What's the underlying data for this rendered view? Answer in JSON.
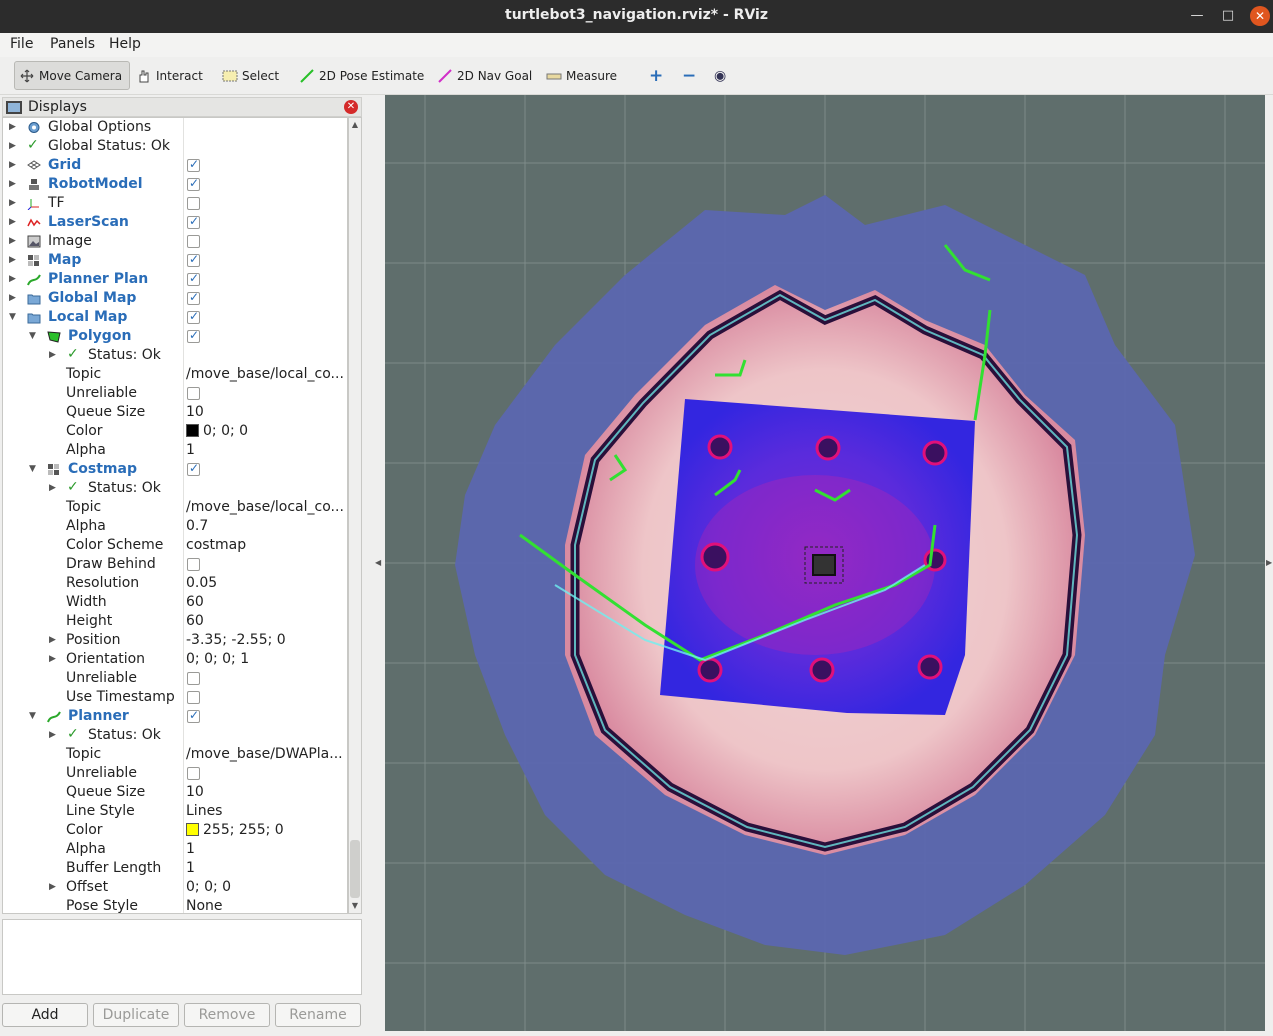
{
  "window": {
    "title": "turtlebot3_navigation.rviz* - RViz",
    "minimize_glyph": "—",
    "maximize_glyph": "□",
    "close_glyph": "✕"
  },
  "menu": [
    "File",
    "Panels",
    "Help"
  ],
  "toolbar": {
    "move_camera": "Move Camera",
    "interact": "Interact",
    "select": "Select",
    "pose_estimate": "2D Pose Estimate",
    "nav_goal": "2D Nav Goal",
    "measure": "Measure"
  },
  "displays": {
    "title": "Displays",
    "rows": [
      {
        "label": "Global Options",
        "value": ""
      },
      {
        "label": "Global Status: Ok",
        "value": ""
      },
      {
        "label": "Grid",
        "value": ""
      },
      {
        "label": "RobotModel",
        "value": ""
      },
      {
        "label": "TF",
        "value": ""
      },
      {
        "label": "LaserScan",
        "value": ""
      },
      {
        "label": "Image",
        "value": ""
      },
      {
        "label": "Map",
        "value": ""
      },
      {
        "label": "Planner Plan",
        "value": ""
      },
      {
        "label": "Global Map",
        "value": ""
      },
      {
        "label": "Local Map",
        "value": ""
      },
      {
        "label": "Polygon",
        "value": ""
      },
      {
        "label": "Status: Ok",
        "value": ""
      },
      {
        "label": "Topic",
        "value": "/move_base/local_co..."
      },
      {
        "label": "Unreliable",
        "value": ""
      },
      {
        "label": "Queue Size",
        "value": "10"
      },
      {
        "label": "Color",
        "value": "0; 0; 0"
      },
      {
        "label": "Alpha",
        "value": "1"
      },
      {
        "label": "Costmap",
        "value": ""
      },
      {
        "label": "Status: Ok",
        "value": ""
      },
      {
        "label": "Topic",
        "value": "/move_base/local_co..."
      },
      {
        "label": "Alpha",
        "value": "0.7"
      },
      {
        "label": "Color Scheme",
        "value": "costmap"
      },
      {
        "label": "Draw Behind",
        "value": ""
      },
      {
        "label": "Resolution",
        "value": "0.05"
      },
      {
        "label": "Width",
        "value": "60"
      },
      {
        "label": "Height",
        "value": "60"
      },
      {
        "label": "Position",
        "value": "-3.35; -2.55; 0"
      },
      {
        "label": "Orientation",
        "value": "0; 0; 0; 1"
      },
      {
        "label": "Unreliable",
        "value": ""
      },
      {
        "label": "Use Timestamp",
        "value": ""
      },
      {
        "label": "Planner",
        "value": ""
      },
      {
        "label": "Status: Ok",
        "value": ""
      },
      {
        "label": "Topic",
        "value": "/move_base/DWAPla..."
      },
      {
        "label": "Unreliable",
        "value": ""
      },
      {
        "label": "Queue Size",
        "value": "10"
      },
      {
        "label": "Line Style",
        "value": "Lines"
      },
      {
        "label": "Color",
        "value": "255; 255; 0"
      },
      {
        "label": "Alpha",
        "value": "1"
      },
      {
        "label": "Buffer Length",
        "value": "1"
      },
      {
        "label": "Offset",
        "value": "0; 0; 0"
      },
      {
        "label": "Pose Style",
        "value": "None"
      }
    ]
  },
  "colors": {
    "polygon_color": "#000000",
    "planner_color": "#ffff00",
    "accent_blue": "#2a6db8"
  },
  "buttons": {
    "add": "Add",
    "duplicate": "Duplicate",
    "remove": "Remove",
    "rename": "Rename"
  }
}
